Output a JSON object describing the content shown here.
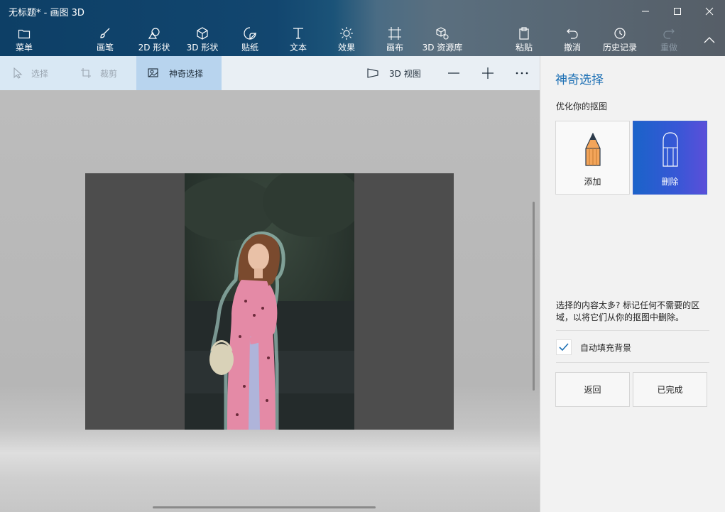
{
  "window": {
    "title": "无标题* - 画图 3D",
    "controls": {
      "minimize_icon": "minimize-icon",
      "maximize_icon": "maximize-icon",
      "close_icon": "close-icon"
    }
  },
  "toolbar": {
    "menu": "菜单",
    "brushes": "画笔",
    "shapes2d": "2D 形状",
    "shapes3d": "3D 形状",
    "stickers": "贴纸",
    "text": "文本",
    "effects": "效果",
    "canvas": "画布",
    "library3d": "3D 资源库",
    "paste": "粘贴",
    "undo": "撤消",
    "history": "历史记录",
    "redo": "重做"
  },
  "subbar": {
    "select": "选择",
    "crop": "裁剪",
    "magic_select": "神奇选择",
    "view3d": "3D 视图",
    "zoom_out_icon": "minus-icon",
    "zoom_in_icon": "plus-icon",
    "more_icon": "more-icon"
  },
  "panel": {
    "title": "神奇选择",
    "subtitle": "优化你的抠图",
    "add_label": "添加",
    "remove_label": "删除",
    "hint": "选择的内容太多? 标记任何不需要的区域，以将它们从你的抠图中删除。",
    "autofill_label": "自动填充背景",
    "autofill_checked": true,
    "back_label": "返回",
    "done_label": "已完成"
  },
  "colors": {
    "accent": "#1b6fb4",
    "active_tool_bg": "#b8d4ee",
    "remove_gradient_start": "#1a63c9",
    "remove_gradient_end": "#5b4fd9"
  }
}
